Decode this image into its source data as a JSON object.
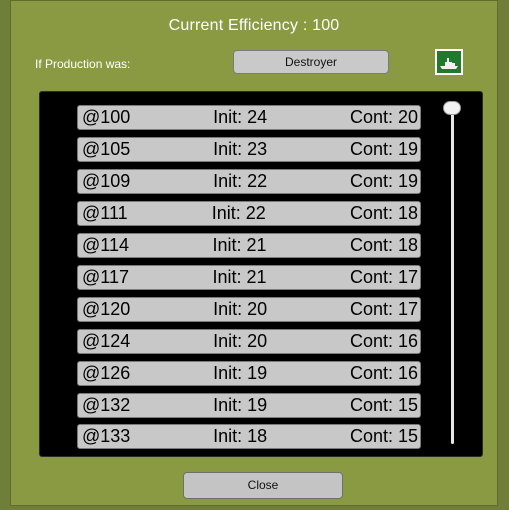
{
  "dialog": {
    "title": "Current Efficiency : 100",
    "production_label": "If Production was:",
    "production_value": "Destroyer",
    "close_label": "Close"
  },
  "icons": {
    "ship": "warship-icon"
  },
  "colors": {
    "dialog_bg": "#8a9a43",
    "list_bg": "#000000",
    "row_bg": "#c8c8c8",
    "icon_bg": "#1f7a2e"
  },
  "rows": [
    {
      "eff": "@100",
      "init": "Init: 24",
      "cont": "Cont: 20"
    },
    {
      "eff": "@105",
      "init": "Init: 23",
      "cont": "Cont: 19"
    },
    {
      "eff": "@109",
      "init": "Init: 22",
      "cont": "Cont: 19"
    },
    {
      "eff": "@111",
      "init": "Init: 22",
      "cont": "Cont: 18"
    },
    {
      "eff": "@114",
      "init": "Init: 21",
      "cont": "Cont: 18"
    },
    {
      "eff": "@117",
      "init": "Init: 21",
      "cont": "Cont: 17"
    },
    {
      "eff": "@120",
      "init": "Init: 20",
      "cont": "Cont: 17"
    },
    {
      "eff": "@124",
      "init": "Init: 20",
      "cont": "Cont: 16"
    },
    {
      "eff": "@126",
      "init": "Init: 19",
      "cont": "Cont: 16"
    },
    {
      "eff": "@132",
      "init": "Init: 19",
      "cont": "Cont: 15"
    },
    {
      "eff": "@133",
      "init": "Init: 18",
      "cont": "Cont: 15"
    }
  ]
}
